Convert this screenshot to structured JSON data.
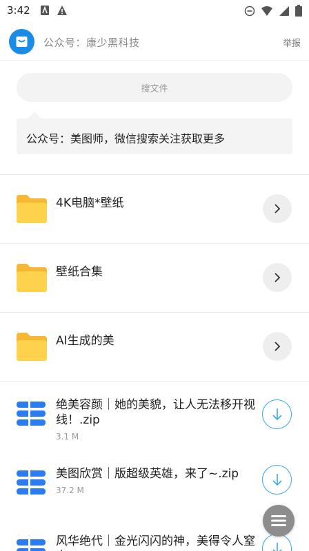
{
  "status_bar": {
    "time": "3:42",
    "left_icons": [
      "gallery-icon",
      "warning-icon"
    ],
    "right_icons": [
      "do-not-disturb-icon",
      "wifi-icon",
      "signal-icon",
      "battery-icon"
    ]
  },
  "header": {
    "title": "公众号：康少黑科技",
    "report_label": "举报",
    "avatar_icon": "bag-icon",
    "brand_color": "#1a8ce8"
  },
  "search": {
    "placeholder": "搜文件"
  },
  "notice": {
    "text": "公众号：美图师，微信搜索关注获取更多"
  },
  "folders": [
    {
      "name": "4K电脑*壁纸"
    },
    {
      "name": "壁纸合集"
    },
    {
      "name": "AI生成的美"
    }
  ],
  "files": [
    {
      "name": "绝美容颜｜她的美貌，让人无法移开视线！.zip",
      "size": "3.1 M"
    },
    {
      "name": "美图欣赏｜版超级英雄，来了~.zip",
      "size": "37.2 M"
    },
    {
      "name": "风华绝代｜金光闪闪的神，美得令人窒息！",
      "size": ""
    }
  ],
  "colors": {
    "folder": "#ffd24d",
    "file_icon": "#2b7cf0",
    "download": "#38a8f0",
    "fab": "#8d8d8d"
  },
  "fab_icon": "menu-icon"
}
